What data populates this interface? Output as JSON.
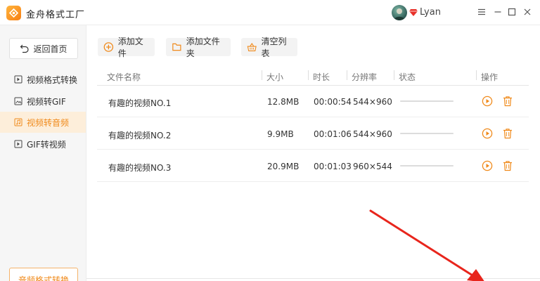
{
  "app": {
    "title": "金舟格式工厂"
  },
  "user": {
    "name": "Lyan"
  },
  "sidebar": {
    "home_label": "返回首页",
    "items": [
      {
        "label": "视频格式转换",
        "active": false
      },
      {
        "label": "视频转GIF",
        "active": false
      },
      {
        "label": "视频转音频",
        "active": true
      },
      {
        "label": "GIF转视频",
        "active": false
      }
    ],
    "bottom_label": "音频格式转换"
  },
  "toolbar": {
    "add_file": "添加文件",
    "add_folder": "添加文件夹",
    "clear_list": "清空列表"
  },
  "table": {
    "headers": {
      "name": "文件名称",
      "size": "大小",
      "duration": "时长",
      "resolution": "分辨率",
      "status": "状态",
      "actions": "操作"
    },
    "rows": [
      {
        "name": "有趣的视频NO.1",
        "size": "12.8MB",
        "duration": "00:00:54",
        "resolution": "544×960",
        "progress": 0
      },
      {
        "name": "有趣的视频NO.2",
        "size": "9.9MB",
        "duration": "00:01:06",
        "resolution": "544×960",
        "progress": 0
      },
      {
        "name": "有趣的视频NO.3",
        "size": "20.9MB",
        "duration": "00:01:03",
        "resolution": "960×544",
        "progress": 0
      }
    ]
  },
  "colors": {
    "accent": "#f08a1b",
    "annotation_arrow": "#e8251c"
  },
  "icons": {
    "logo": "app-logo-icon",
    "vip": "vip-diamond-icon",
    "home": "back-arrow-icon",
    "add_file": "plus-circle-icon",
    "add_folder": "folder-icon",
    "clear": "basket-icon",
    "play": "play-icon",
    "delete": "trash-icon",
    "minimize": "minimize-icon",
    "menu": "menu-icon",
    "maximize": "maximize-icon",
    "close": "close-icon"
  }
}
